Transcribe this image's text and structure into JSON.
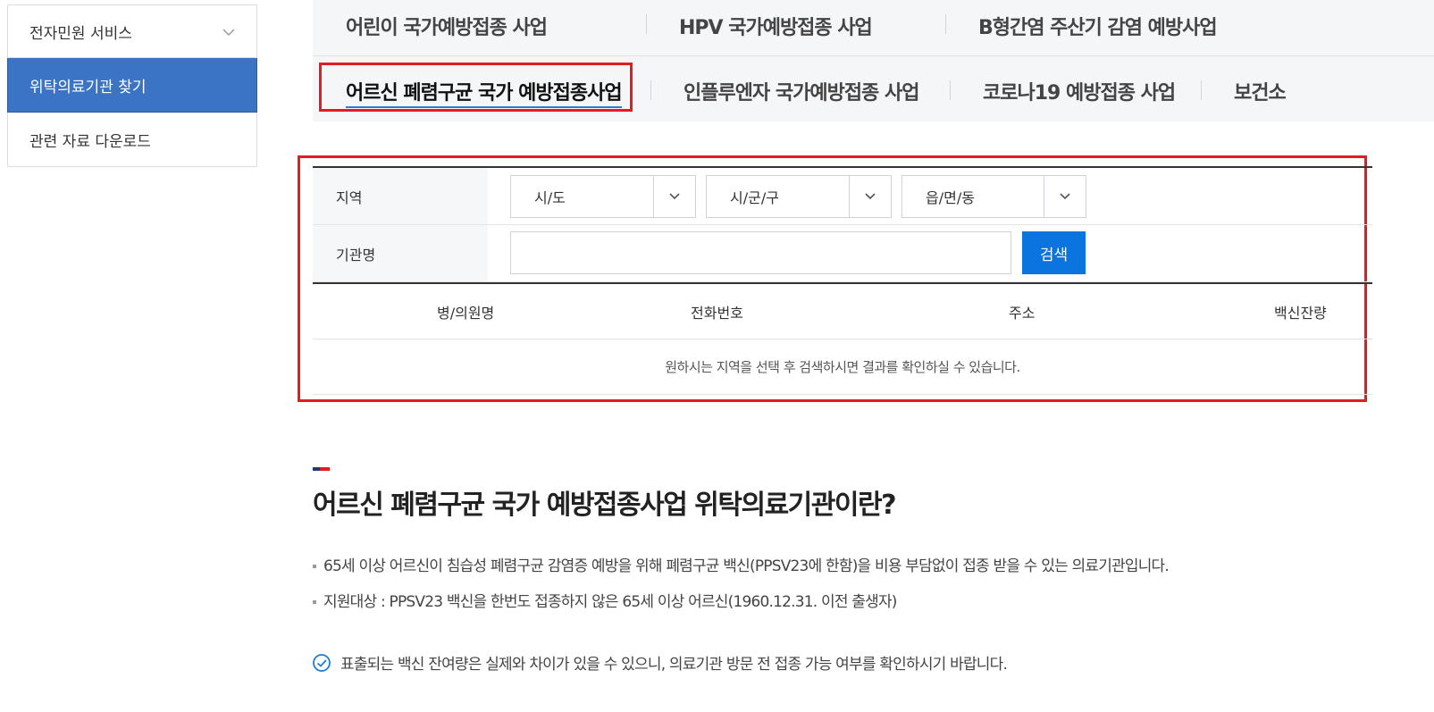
{
  "sidebar": {
    "items": [
      {
        "label": "전자민원 서비스"
      },
      {
        "label": "위탁의료기관 찾기"
      },
      {
        "label": "관련 자료 다운로드"
      }
    ]
  },
  "tabs": {
    "row1": [
      {
        "label": "어린이 국가예방접종 사업"
      },
      {
        "label": "HPV 국가예방접종 사업"
      },
      {
        "label": "B형간염 주산기 감염 예방사업"
      }
    ],
    "row2": [
      {
        "label": "어르신 폐렴구균 국가 예방접종사업"
      },
      {
        "label": "인플루엔자 국가예방접종 사업"
      },
      {
        "label": "코로나19 예방접종 사업"
      },
      {
        "label": "보건소"
      }
    ]
  },
  "search": {
    "region_label": "지역",
    "sido": "시/도",
    "sigungu": "시/군/구",
    "eupmyeondong": "읍/면/동",
    "org_label": "기관명",
    "org_value": "",
    "button": "검색"
  },
  "results": {
    "columns": [
      "병/의원명",
      "전화번호",
      "주소",
      "백신잔량"
    ],
    "empty_message": "원하시는 지역을 선택 후 검색하시면 결과를 확인하실 수 있습니다."
  },
  "info": {
    "title": "어르신 폐렴구균 국가 예방접종사업 위탁의료기관이란?",
    "bullets": [
      "65세 이상 어르신이 침습성 폐렴구균 감염증 예방을 위해 폐렴구균 백신(PPSV23에 한함)을 비용 부담없이 접종 받을 수 있는 의료기관입니다.",
      "지원대상 : PPSV23 백신을 한번도 접종하지 않은 65세 이상 어르신(1960.12.31. 이전 출생자)"
    ],
    "notice": "표출되는 백신 잔여량은 실제와 차이가 있을 수 있으니, 의료기관 방문 전 접종 가능 여부를 확인하시기 바랍니다."
  },
  "colors": {
    "accent_blue": "#3b74c5",
    "button_blue": "#0b74de",
    "highlight_red": "#e31b23",
    "tab_background": "#f5f6f8"
  }
}
